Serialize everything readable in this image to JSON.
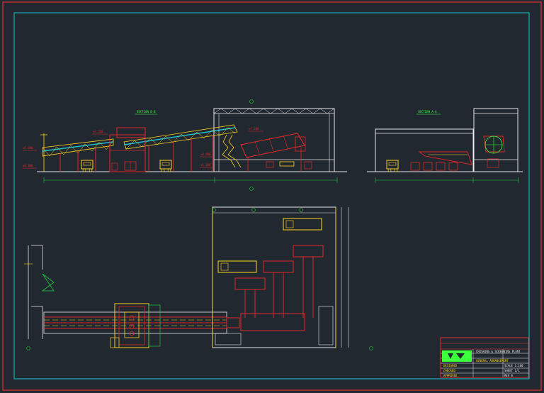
{
  "drawing": {
    "background": "#212830",
    "colors": {
      "frame": "#e03030",
      "inner_frame": "#19c3d6",
      "structure": "#e8e8e8",
      "conveyor": "#ffd21e",
      "equipment": "#e02828",
      "dimension": "#1ecc3a",
      "highlight": "#3aff3a"
    },
    "sections": [
      {
        "id": "section-b",
        "title": "SECTION B-B"
      },
      {
        "id": "section-a",
        "title": "SECTION A-A"
      }
    ],
    "level_marks": [
      "+5.000",
      "±0.000",
      "+3.500",
      "+7.200",
      "+4.800",
      "+1.200"
    ],
    "title_block": {
      "project": "CRUSHING & SCREENING PLANT",
      "drawing_title": "GENERAL ARRANGEMENT",
      "rows": [
        "DESIGNED",
        "CHECKED",
        "APPROVED",
        "SCALE 1:100",
        "SHEET 1/1",
        "REV 0"
      ]
    }
  }
}
